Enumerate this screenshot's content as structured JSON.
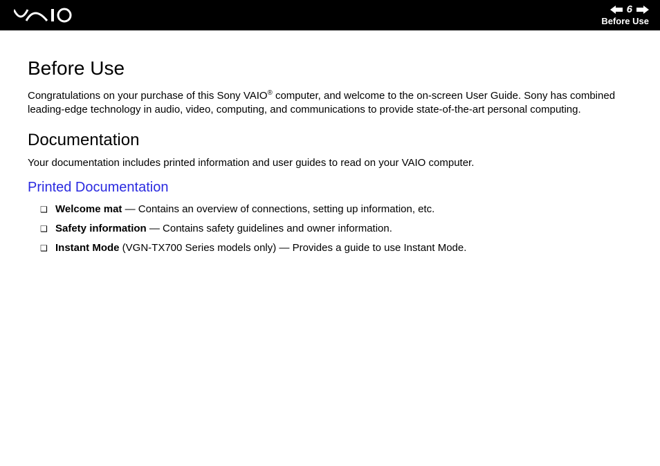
{
  "header": {
    "page_number": "6",
    "section_label": "Before Use"
  },
  "content": {
    "title": "Before Use",
    "intro_pre": "Congratulations on your purchase of this Sony VAIO",
    "intro_post": " computer, and welcome to the on-screen User Guide. Sony has combined leading-edge technology in audio, video, computing, and communications to provide state-of-the-art personal computing.",
    "doc_heading": "Documentation",
    "doc_line": "Your documentation includes printed information and user guides to read on your VAIO computer.",
    "printed_heading": "Printed Documentation",
    "bullets": [
      {
        "bold": "Welcome mat",
        "rest": " — Contains an overview of connections, setting up information, etc."
      },
      {
        "bold": "Safety information",
        "rest": " — Contains safety guidelines and owner information."
      },
      {
        "bold": "Instant Mode",
        "rest": " (VGN-TX700 Series models only) — Provides a guide to use Instant Mode."
      }
    ]
  }
}
